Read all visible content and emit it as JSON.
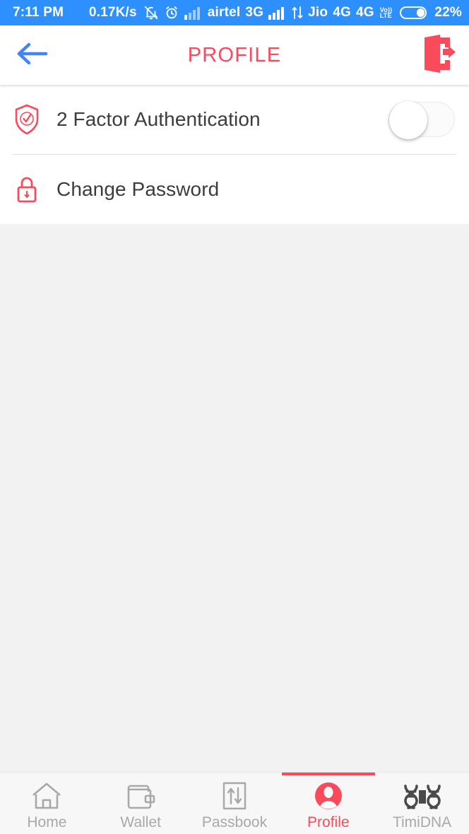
{
  "status_bar": {
    "time": "7:11 PM",
    "network_speed": "0.17K/s",
    "icons": [
      "bell-mute-icon",
      "alarm-clock-icon",
      "signal-bars-icon",
      "signal-bars-icon",
      "data-transfer-icon",
      "volte-icon"
    ],
    "carrier_1": "airtel",
    "network_1": "3G",
    "carrier_2": "Jio",
    "network_2": "4G",
    "network_3": "4G",
    "volte_top": "Vo))",
    "volte_bottom": "LTE",
    "battery_percent": "22%",
    "background_color": "#2e8fff",
    "text_color": "#ffffff"
  },
  "header": {
    "title": "PROFILE",
    "back_icon": "arrow-left-icon",
    "back_color": "#4285f4",
    "logout_icon": "logout-door-icon",
    "logout_color": "#fb4a5c",
    "title_color": "#fb4a5c"
  },
  "settings": {
    "rows": [
      {
        "label": "2 Factor Authentication",
        "icon": "shield-check-icon",
        "control": "toggle",
        "toggle_on": false
      },
      {
        "label": "Change Password",
        "icon": "lock-icon",
        "control": "none"
      }
    ]
  },
  "bottom_nav": {
    "active_index": 3,
    "accent_color": "#fb4a5c",
    "inactive_color": "#a8a8a8",
    "items": [
      {
        "label": "Home",
        "icon": "home-icon"
      },
      {
        "label": "Wallet",
        "icon": "wallet-icon"
      },
      {
        "label": "Passbook",
        "icon": "passbook-transfer-icon"
      },
      {
        "label": "Profile",
        "icon": "profile-person-icon"
      },
      {
        "label": "TimiDNA",
        "icon": "dna-helix-icon"
      }
    ]
  },
  "theme": {
    "accent_red": "#fb4a5c",
    "page_background": "#f2f2f2",
    "card_background": "#ffffff",
    "text_primary": "#3c3c3c"
  }
}
